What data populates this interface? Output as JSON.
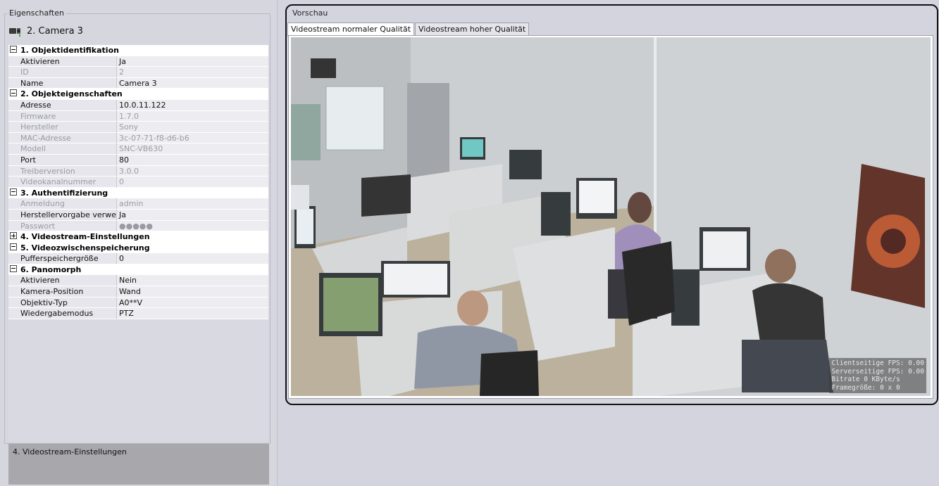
{
  "properties_panel": {
    "title": "Eigenschaften",
    "object_name": "2. Camera 3",
    "categories": [
      {
        "label": "1. Objektidentifikation",
        "expanded": true,
        "rows": [
          {
            "key": "Aktivieren",
            "value": "Ja",
            "readonly": false
          },
          {
            "key": "ID",
            "value": "2",
            "readonly": true
          },
          {
            "key": "Name",
            "value": "Camera 3",
            "readonly": false
          }
        ]
      },
      {
        "label": "2. Objekteigenschaften",
        "expanded": true,
        "rows": [
          {
            "key": "Adresse",
            "value": "10.0.11.122",
            "readonly": false
          },
          {
            "key": "Firmware",
            "value": "1.7.0",
            "readonly": true
          },
          {
            "key": "Hersteller",
            "value": "Sony",
            "readonly": true
          },
          {
            "key": "MAC-Adresse",
            "value": "3c-07-71-f8-d6-b6",
            "readonly": true
          },
          {
            "key": "Modell",
            "value": "SNC-VB630",
            "readonly": true
          },
          {
            "key": "Port",
            "value": "80",
            "readonly": false
          },
          {
            "key": "Treiberversion",
            "value": "3.0.0",
            "readonly": true
          },
          {
            "key": "Videokanalnummer",
            "value": "0",
            "readonly": true
          }
        ]
      },
      {
        "label": "3. Authentifizierung",
        "expanded": true,
        "rows": [
          {
            "key": "Anmeldung",
            "value": "admin",
            "readonly": true
          },
          {
            "key": "Herstellervorgabe verwend",
            "value": "Ja",
            "readonly": false
          },
          {
            "key": "Passwort",
            "value": "●●●●●",
            "readonly": true
          }
        ]
      },
      {
        "label": "4. Videostream-Einstellungen",
        "expanded": false,
        "rows": []
      },
      {
        "label": "5. Videozwischenspeicherung",
        "expanded": true,
        "rows": [
          {
            "key": "Pufferspeichergröße",
            "value": "0",
            "readonly": false
          }
        ]
      },
      {
        "label": "6. Panomorph",
        "expanded": true,
        "rows": [
          {
            "key": "Aktivieren",
            "value": "Nein",
            "readonly": false
          },
          {
            "key": "Kamera-Position",
            "value": "Wand",
            "readonly": false
          },
          {
            "key": "Objektiv-Typ",
            "value": "A0**V",
            "readonly": false
          },
          {
            "key": "Wiedergabemodus",
            "value": "PTZ",
            "readonly": false
          }
        ]
      }
    ],
    "description": "4. Videostream-Einstellungen"
  },
  "preview": {
    "title": "Vorschau",
    "tabs": [
      {
        "label": "Videostream normaler Qualität",
        "active": true
      },
      {
        "label": "Videostream hoher Qualität",
        "active": false
      }
    ],
    "overlay": [
      "Clientseitige FPS: 0.00",
      "Serverseitige FPS: 0.00",
      "Bitrate 0 KByte/s",
      "Framegröße: 0 x 0"
    ]
  }
}
